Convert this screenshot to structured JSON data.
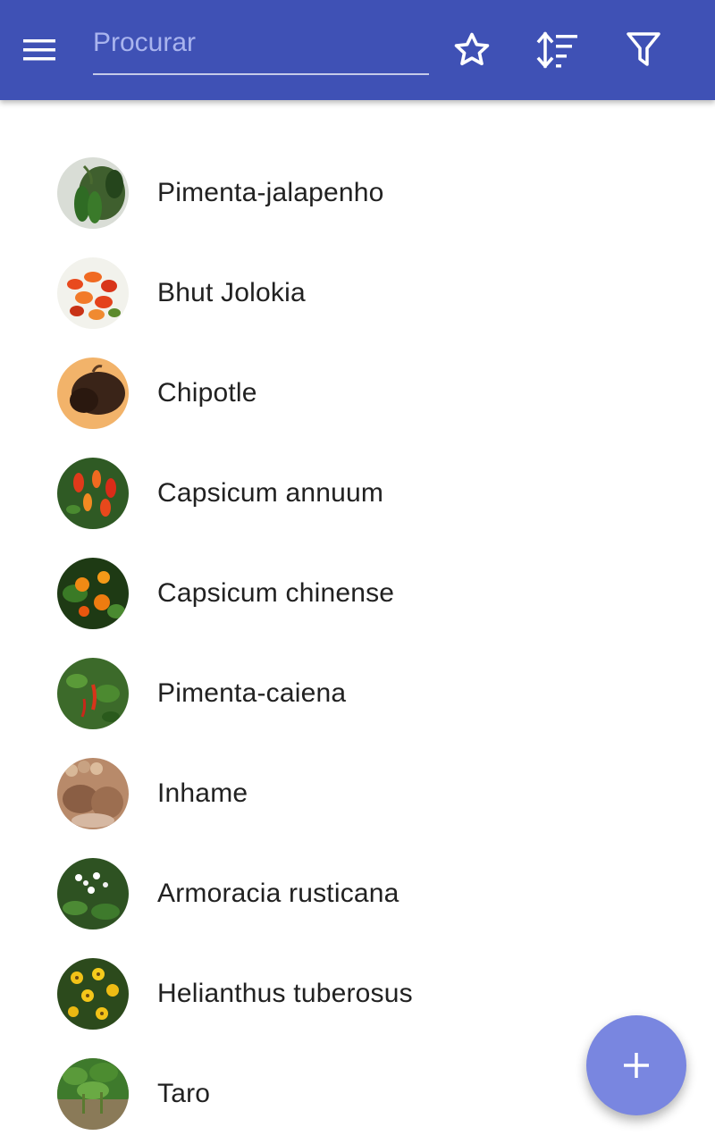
{
  "toolbar": {
    "menu_icon": "menu-icon",
    "search_placeholder": "Procurar",
    "search_value": "",
    "favorites_icon": "star-outline-icon",
    "sort_icon": "sort-icon",
    "filter_icon": "filter-icon",
    "background_color": "#3f51b5"
  },
  "items": [
    {
      "name": "Pimenta-jalapenho"
    },
    {
      "name": "Bhut Jolokia"
    },
    {
      "name": "Chipotle"
    },
    {
      "name": "Capsicum annuum"
    },
    {
      "name": "Capsicum chinense"
    },
    {
      "name": "Pimenta-caiena"
    },
    {
      "name": "Inhame"
    },
    {
      "name": "Armoracia rusticana"
    },
    {
      "name": "Helianthus tuberosus"
    },
    {
      "name": "Taro"
    }
  ],
  "fab": {
    "icon": "plus-icon",
    "color": "#7986e0"
  }
}
